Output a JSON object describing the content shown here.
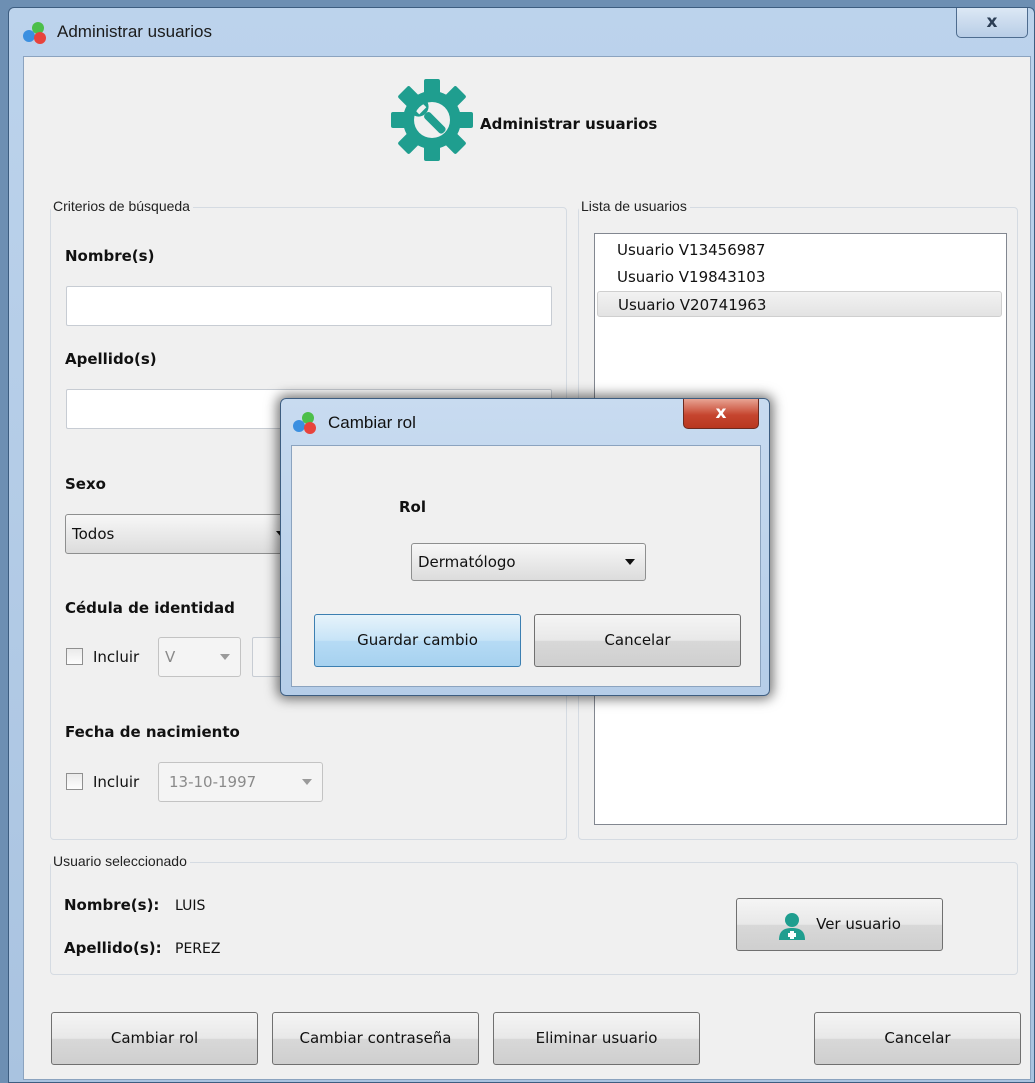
{
  "window": {
    "title": "Administrar usuarios",
    "close": "x"
  },
  "header": {
    "title": "Administrar usuarios"
  },
  "search": {
    "group_label": "Criterios de búsqueda",
    "nombre_label": "Nombre(s)",
    "apellido_label": "Apellido(s)",
    "sexo_label": "Sexo",
    "sexo_value": "Todos",
    "cedula_label": "Cédula de identidad",
    "cedula_incluir": "Incluir",
    "cedula_prefix": "V",
    "fecha_label": "Fecha de nacimiento",
    "fecha_incluir": "Incluir",
    "fecha_value": "13-10-1997"
  },
  "users": {
    "group_label": "Lista de usuarios",
    "items": [
      "Usuario V13456987",
      "Usuario V19843103",
      "Usuario V20741963"
    ],
    "selected_index": 2
  },
  "selected_user": {
    "group_label": "Usuario seleccionado",
    "nombre_label": "Nombre(s):",
    "nombre_value": "LUIS",
    "apellido_label": "Apellido(s):",
    "apellido_value": "PEREZ",
    "ver_button": "Ver usuario"
  },
  "actions": {
    "cambiar_rol": "Cambiar rol",
    "cambiar_contrasena": "Cambiar contraseña",
    "eliminar_usuario": "Eliminar usuario",
    "cancelar": "Cancelar"
  },
  "dialog": {
    "title": "Cambiar rol",
    "close": "x",
    "rol_label": "Rol",
    "rol_value": "Dermatólogo",
    "guardar": "Guardar cambio",
    "cancelar": "Cancelar"
  },
  "colors": {
    "gear": "#1f9e8f",
    "window_frame": "#b9d0ea",
    "selection": "#e4e4e4"
  }
}
